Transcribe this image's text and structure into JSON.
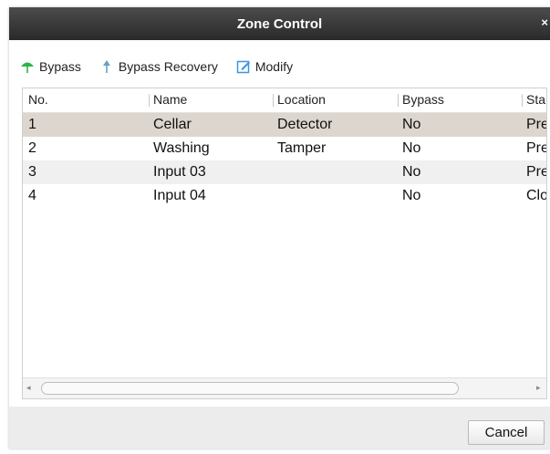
{
  "dialog": {
    "title": "Zone Control",
    "close_glyph": "×"
  },
  "toolbar": {
    "bypass": {
      "label": "Bypass",
      "icon": "umbrella-icon",
      "color": "#2db34a"
    },
    "bypass_recovery": {
      "label": "Bypass Recovery",
      "icon": "pin-icon",
      "color": "#6a9fc6"
    },
    "modify": {
      "label": "Modify",
      "icon": "edit-icon",
      "color": "#3b95e0"
    }
  },
  "table": {
    "columns": [
      "No.",
      "Name",
      "Location",
      "Bypass",
      "Sta"
    ],
    "rows": [
      {
        "no": "1",
        "name": "Cellar",
        "location": "Detector",
        "bypass": "No",
        "status": "Pre",
        "selected": true
      },
      {
        "no": "2",
        "name": "Washing",
        "location": "Tamper",
        "bypass": "No",
        "status": "Pre",
        "selected": false
      },
      {
        "no": "3",
        "name": "Input 03",
        "location": "",
        "bypass": "No",
        "status": "Pre",
        "selected": false
      },
      {
        "no": "4",
        "name": "Input 04",
        "location": "",
        "bypass": "No",
        "status": "Clo",
        "selected": false
      }
    ],
    "selected_row_color": "#ddd6cf",
    "alt_row_color": "#f0f0f0"
  },
  "scrollbar": {
    "left_glyph": "◂",
    "right_glyph": "▸"
  },
  "footer": {
    "cancel_label": "Cancel"
  }
}
